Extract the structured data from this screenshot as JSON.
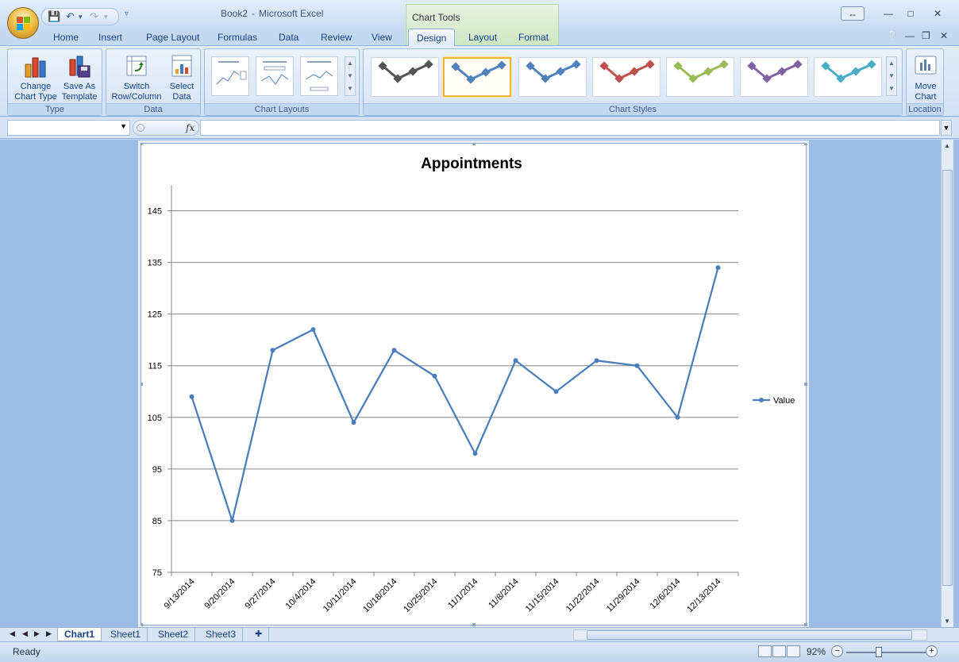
{
  "window": {
    "document_name": "Book2",
    "separator": "-",
    "app_name": "Microsoft Excel",
    "contextual_tab": "Chart Tools"
  },
  "tabs": [
    {
      "label": "Home"
    },
    {
      "label": "Insert"
    },
    {
      "label": "Page Layout"
    },
    {
      "label": "Formulas"
    },
    {
      "label": "Data"
    },
    {
      "label": "Review"
    },
    {
      "label": "View"
    },
    {
      "label": "Design"
    },
    {
      "label": "Layout"
    },
    {
      "label": "Format"
    }
  ],
  "ribbon": {
    "type_group": {
      "label": "Type",
      "change_line1": "Change",
      "change_line2": "Chart Type",
      "save_line1": "Save As",
      "save_line2": "Template"
    },
    "data_group": {
      "label": "Data",
      "switch_line1": "Switch",
      "switch_line2": "Row/Column",
      "select_line1": "Select",
      "select_line2": "Data"
    },
    "layouts_group": {
      "label": "Chart Layouts"
    },
    "styles_group": {
      "label": "Chart Styles",
      "style_colors": [
        "#555555",
        "#4f81bd",
        "#4f81bd",
        "#c0504d",
        "#9bbb59",
        "#8064a2",
        "#4bacc6"
      ]
    },
    "location_group": {
      "label": "Location",
      "move_line1": "Move",
      "move_line2": "Chart"
    }
  },
  "formula_bar": {
    "name_box": "",
    "fx_label": "fx",
    "formula": ""
  },
  "chart_data": {
    "type": "line",
    "title": "Appointments",
    "x": [
      "9/13/2014",
      "9/20/2014",
      "9/27/2014",
      "10/4/2014",
      "10/11/2014",
      "10/18/2014",
      "10/25/2014",
      "11/1/2014",
      "11/8/2014",
      "11/15/2014",
      "11/22/2014",
      "11/29/2014",
      "12/6/2014",
      "12/13/2014"
    ],
    "series": [
      {
        "name": "Value",
        "values": [
          109,
          85,
          118,
          122,
          104,
          118,
          113,
          98,
          116,
          110,
          116,
          115,
          105,
          134
        ],
        "color": "#4a7ebb"
      }
    ],
    "ylim": [
      75,
      150
    ],
    "yticks": [
      75,
      85,
      95,
      105,
      115,
      125,
      135,
      145
    ],
    "grid": true,
    "legend": "right"
  },
  "sheets": [
    {
      "label": "Chart1",
      "active": true
    },
    {
      "label": "Sheet1"
    },
    {
      "label": "Sheet2"
    },
    {
      "label": "Sheet3"
    }
  ],
  "status": {
    "text": "Ready",
    "zoom": "92%",
    "zoom_value": 92
  }
}
